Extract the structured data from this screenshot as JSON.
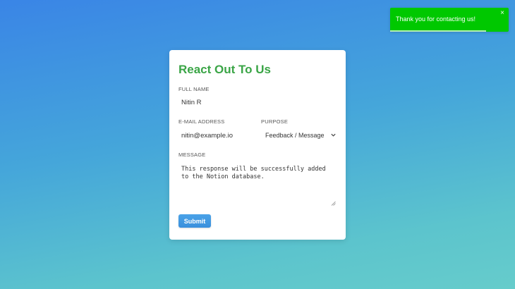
{
  "toast": {
    "message": "Thank you for contacting us!",
    "close_icon": "×",
    "progress": 0.81,
    "color": "#00c800"
  },
  "form": {
    "title": "React Out To Us",
    "full_name": {
      "label": "FULL NAME",
      "value": "Nitin R"
    },
    "email": {
      "label": "E-MAIL ADDRESS",
      "value": "nitin@example.io"
    },
    "purpose": {
      "label": "PURPOSE",
      "selected": "Feedback / Message"
    },
    "message": {
      "label": "MESSAGE",
      "value": "This response will be successfully added\nto the Notion database."
    },
    "submit_label": "Submit"
  },
  "colors": {
    "title": "#3aa546",
    "submit": "#3a8fdc",
    "background_top": "#3a85e6",
    "background_bottom": "#66cccb"
  }
}
